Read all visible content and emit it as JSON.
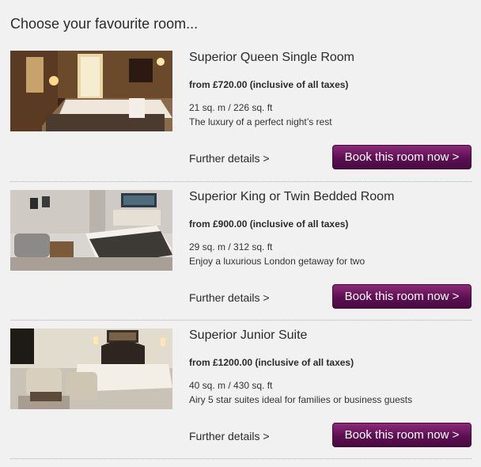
{
  "heading": "Choose your favourite room...",
  "rooms": [
    {
      "title": "Superior Queen Single Room",
      "price": "from £720.00 (inclusive of all taxes)",
      "size": "21 sq. m / 226 sq. ft",
      "description": "The luxury of a perfect night’s rest",
      "details_label": "Further details >",
      "book_label": "Book this room now >"
    },
    {
      "title": "Superior King or Twin Bedded Room",
      "price": "from £900.00 (inclusive of all taxes)",
      "size": "29 sq. m / 312 sq. ft",
      "description": "Enjoy a luxurious London getaway for two",
      "details_label": "Further details >",
      "book_label": "Book this room now >"
    },
    {
      "title": "Superior Junior Suite",
      "price": "from £1200.00 (inclusive of all taxes)",
      "size": "40 sq. m / 430 sq. ft",
      "description": "Airy 5 star suites ideal for families or business guests",
      "details_label": "Further details >",
      "book_label": "Book this room now >"
    }
  ],
  "colors": {
    "button_top": "#8c2a77",
    "button_bottom": "#4a0a42",
    "background": "#f2f1f2"
  }
}
